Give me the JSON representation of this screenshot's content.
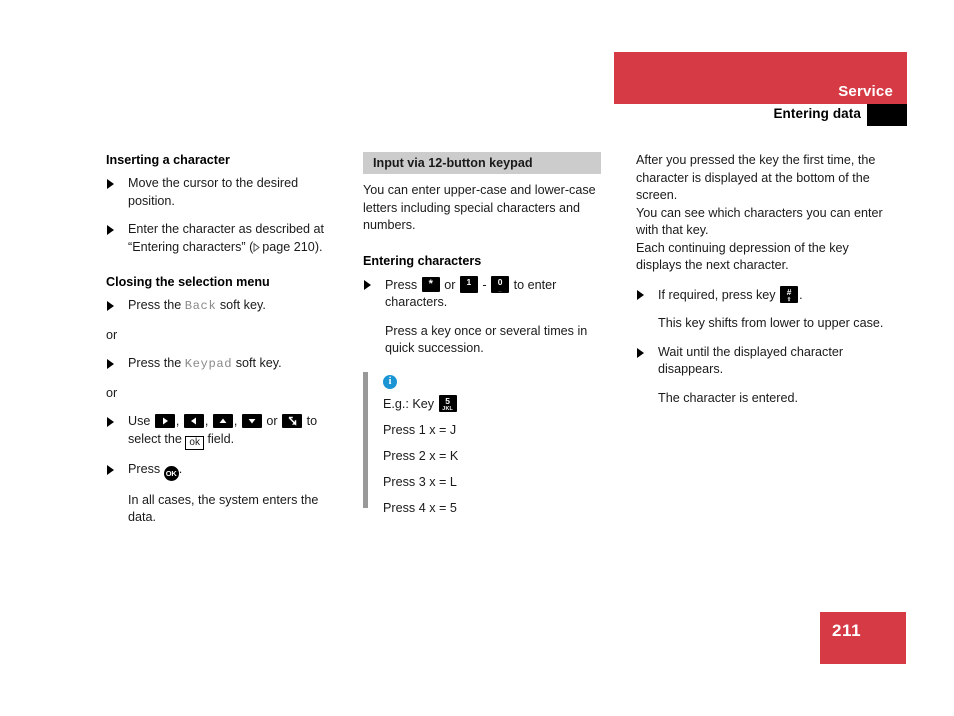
{
  "header": {
    "title": "Service",
    "subtitle": "Entering data",
    "accent_color": "#d63a45",
    "tab_color": "#000000"
  },
  "left_column": {
    "section1_title": "Inserting a character",
    "item1": "Move the cursor to the desired position.",
    "item2_pre": "Enter the character as described at “Entering characters” (",
    "item2_ref": "page 210",
    "item2_post": ").",
    "section2_title": "Closing the selection menu",
    "press_the": "Press the",
    "back_key": "Back",
    "soft_key_suffix": "soft key.",
    "or_1": "or",
    "keypad_key": "Keypad",
    "or_2": "or",
    "use_word": "Use",
    "comma": ",",
    "or_word": "or",
    "to_select": "to select the",
    "ok_field": "ok",
    "field_word": "field.",
    "press_word": "Press",
    "ok_button": "OK",
    "period": ".",
    "final_note": "In all cases, the system enters the data."
  },
  "middle_column": {
    "gray_heading": "Input via 12-button keypad",
    "intro": "You can enter upper-case and lower-case letters including special characters and numbers.",
    "section_title": "Entering characters",
    "press_word": "Press",
    "star_key": "*",
    "or_word": "or",
    "key_1_top": "1",
    "key_1_bot": "",
    "dash": "-",
    "key_0_top": "0",
    "key_0_bot": "_",
    "to_enter": "to enter characters.",
    "succession": "Press a key once or several times in quick succession.",
    "note": {
      "icon": "info-icon",
      "eg_label": "E.g.: Key",
      "eg_key_top": "5",
      "eg_key_bot": "JKL",
      "lines": [
        "Press 1 x = J",
        "Press 2 x = K",
        "Press 3 x = L",
        "Press 4 x = 5"
      ]
    }
  },
  "right_column": {
    "para1": "After you pressed the key the first time, the character is displayed at the bottom of the screen.",
    "para2": "You can see which characters you can enter with that key.",
    "para3": "Each continuing depression of the key displays the next character.",
    "item1_pre": "If required, press key",
    "hash_key_top": "#",
    "hash_key_bot": "⇧",
    "item1_post": ".",
    "item1_sub": "This key shifts from lower to upper case.",
    "item2": "Wait until the displayed character disappears.",
    "item2_sub": "The character is entered."
  },
  "footer": {
    "page_number": "211"
  }
}
